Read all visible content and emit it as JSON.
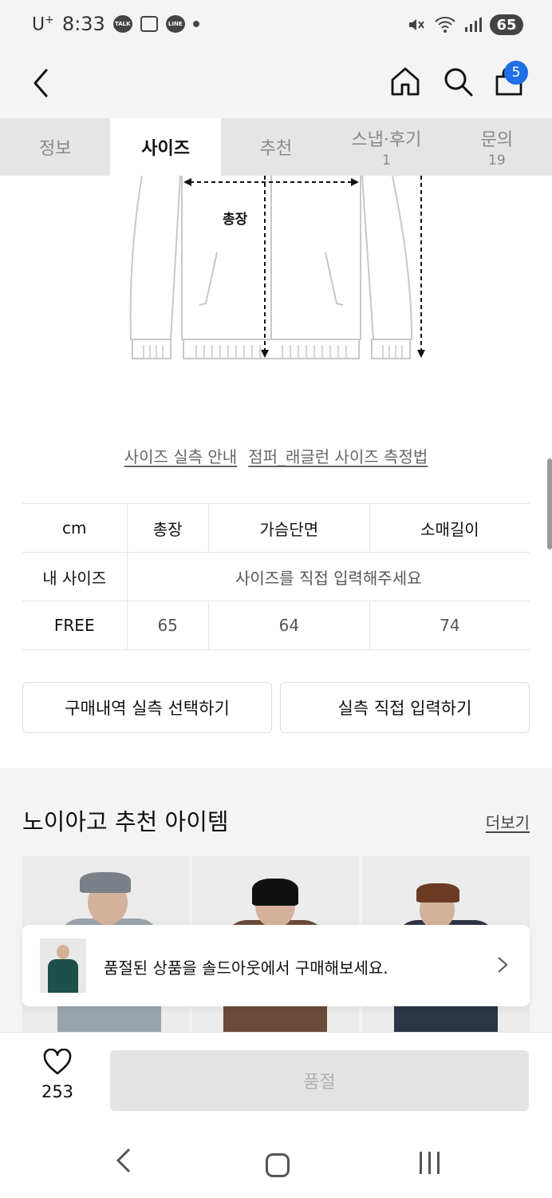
{
  "status_bar": {
    "carrier": "U",
    "carrier_sup": "+",
    "time": "8:33",
    "app_icons": [
      "talk-icon",
      "screenshot-icon",
      "line-icon"
    ],
    "battery": "65"
  },
  "header": {
    "cart_count": "5"
  },
  "tabs": [
    {
      "label": "정보",
      "sub": ""
    },
    {
      "label": "사이즈",
      "sub": ""
    },
    {
      "label": "추천",
      "sub": ""
    },
    {
      "label": "스냅·후기",
      "sub": "1"
    },
    {
      "label": "문의",
      "sub": "19"
    }
  ],
  "diagram": {
    "label": "총장"
  },
  "size_links": {
    "guide": "사이즈 실측 안내",
    "method": "점퍼_래글런 사이즈 측정법"
  },
  "size_table": {
    "header": [
      "cm",
      "총장",
      "가슴단면",
      "소매길이"
    ],
    "my_size_label": "내 사이즈",
    "my_size_prompt": "사이즈를 직접 입력해주세요",
    "rows": [
      {
        "label": "FREE",
        "values": [
          "65",
          "64",
          "74"
        ]
      }
    ]
  },
  "actions": {
    "select_history": "구매내역 실측 선택하기",
    "direct_input": "실측 직접 입력하기"
  },
  "recommend": {
    "title": "노이아고 추천 아이템",
    "more": "더보기"
  },
  "soldout_banner": {
    "text": "품절된 상품을 솔드아웃에서 구매해보세요."
  },
  "bottom_bar": {
    "like_count": "253",
    "soldout_label": "품절"
  },
  "colors": {
    "accent": "#1f6fe6",
    "tab_bg": "#e5e5e5",
    "soldout_btn_bg": "#e4e4e4"
  }
}
